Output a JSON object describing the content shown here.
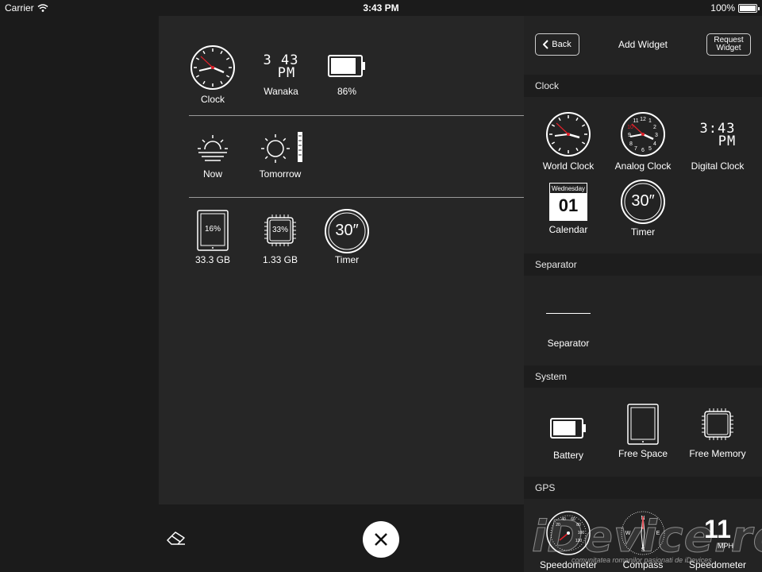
{
  "status_bar": {
    "carrier": "Carrier",
    "time": "3:43 PM",
    "battery": "100%"
  },
  "dashboard": {
    "row1": [
      {
        "label": "Clock",
        "icon": "analog-clock-icon"
      },
      {
        "label": "Wanaka",
        "icon": "digital-clock-icon",
        "time_top": "3 43",
        "time_bottom": "PM"
      },
      {
        "label": "86%",
        "icon": "battery-icon",
        "level": 0.86
      }
    ],
    "row2": [
      {
        "label": "Now",
        "icon": "fog-sun-icon"
      },
      {
        "label": "Tomorrow",
        "icon": "sun-icon"
      }
    ],
    "row3": [
      {
        "label": "33.3 GB",
        "icon": "tablet-icon",
        "value": "16%"
      },
      {
        "label": "1.33 GB",
        "icon": "chip-icon",
        "value": "33%"
      },
      {
        "label": "Timer",
        "icon": "timer-icon",
        "value": "30″"
      }
    ]
  },
  "bottom_bar": {
    "close_icon": "close-icon",
    "eraser_icon": "eraser-icon"
  },
  "sidebar": {
    "back_label": "Back",
    "title": "Add Widget",
    "request_label_1": "Request",
    "request_label_2": "Widget",
    "sections": {
      "clock": {
        "title": "Clock",
        "items": [
          {
            "label": "World Clock"
          },
          {
            "label": "Analog Clock"
          },
          {
            "label": "Digital Clock",
            "time_top": "3:43",
            "time_bottom": "PM"
          },
          {
            "label": "Calendar",
            "day": "Wednesday",
            "date": "01"
          },
          {
            "label": "Timer",
            "value": "30″"
          }
        ]
      },
      "separator": {
        "title": "Separator",
        "items": [
          {
            "label": "Separator"
          }
        ]
      },
      "system": {
        "title": "System",
        "items": [
          {
            "label": "Battery"
          },
          {
            "label": "Free Space"
          },
          {
            "label": "Free Memory"
          }
        ]
      },
      "gps": {
        "title": "GPS",
        "items": [
          {
            "label": "Speedometer"
          },
          {
            "label": "Compass"
          },
          {
            "label": "Speedometer",
            "value": "11",
            "unit": "MPH"
          }
        ]
      }
    }
  },
  "watermark": {
    "text": "iDevice.ro",
    "subtext": "comunitatea romanilor pasionati de iDevices"
  },
  "colors": {
    "background": "#1b1b1b",
    "panel": "#262626",
    "sidebar": "#232323",
    "section_header": "#1d1d1d",
    "clock_second_hand": "#e0202a"
  }
}
